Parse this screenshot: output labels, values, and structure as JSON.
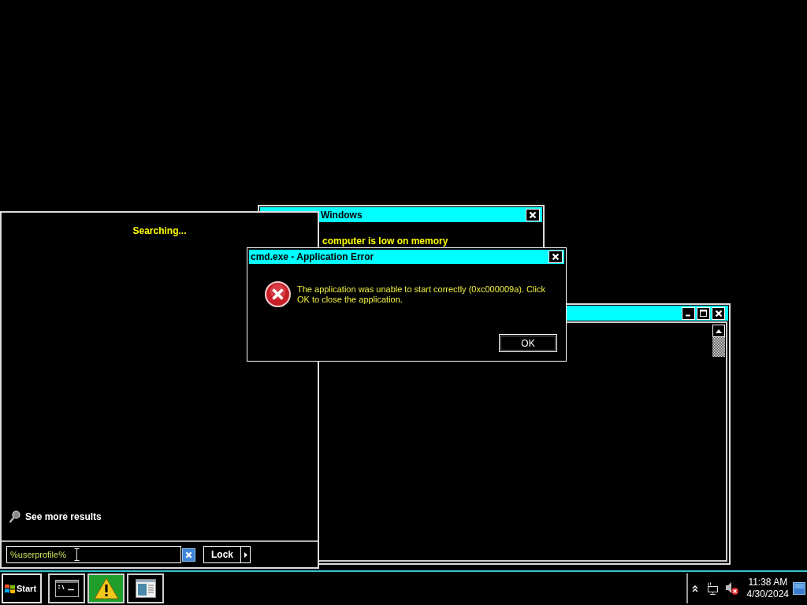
{
  "memory_window": {
    "title": "Windows",
    "message": "computer is low on memory"
  },
  "error_dialog": {
    "title": "cmd.exe - Application Error",
    "message": "The application was unable to start correctly (0xc000009a). Click OK to close the application.",
    "buttons": [
      "OK"
    ]
  },
  "start_menu": {
    "status": "Searching...",
    "see_more": "See more results",
    "search": {
      "value": "%userprofile%"
    },
    "power_button": "Lock"
  },
  "taskbar": {
    "start": "Start",
    "buttons": [
      {
        "kind": "console",
        "selected": false
      },
      {
        "kind": "warning",
        "selected": true
      },
      {
        "kind": "window",
        "selected": false
      }
    ],
    "clock": {
      "time": "11:38 AM",
      "date": "4/30/2024"
    }
  }
}
